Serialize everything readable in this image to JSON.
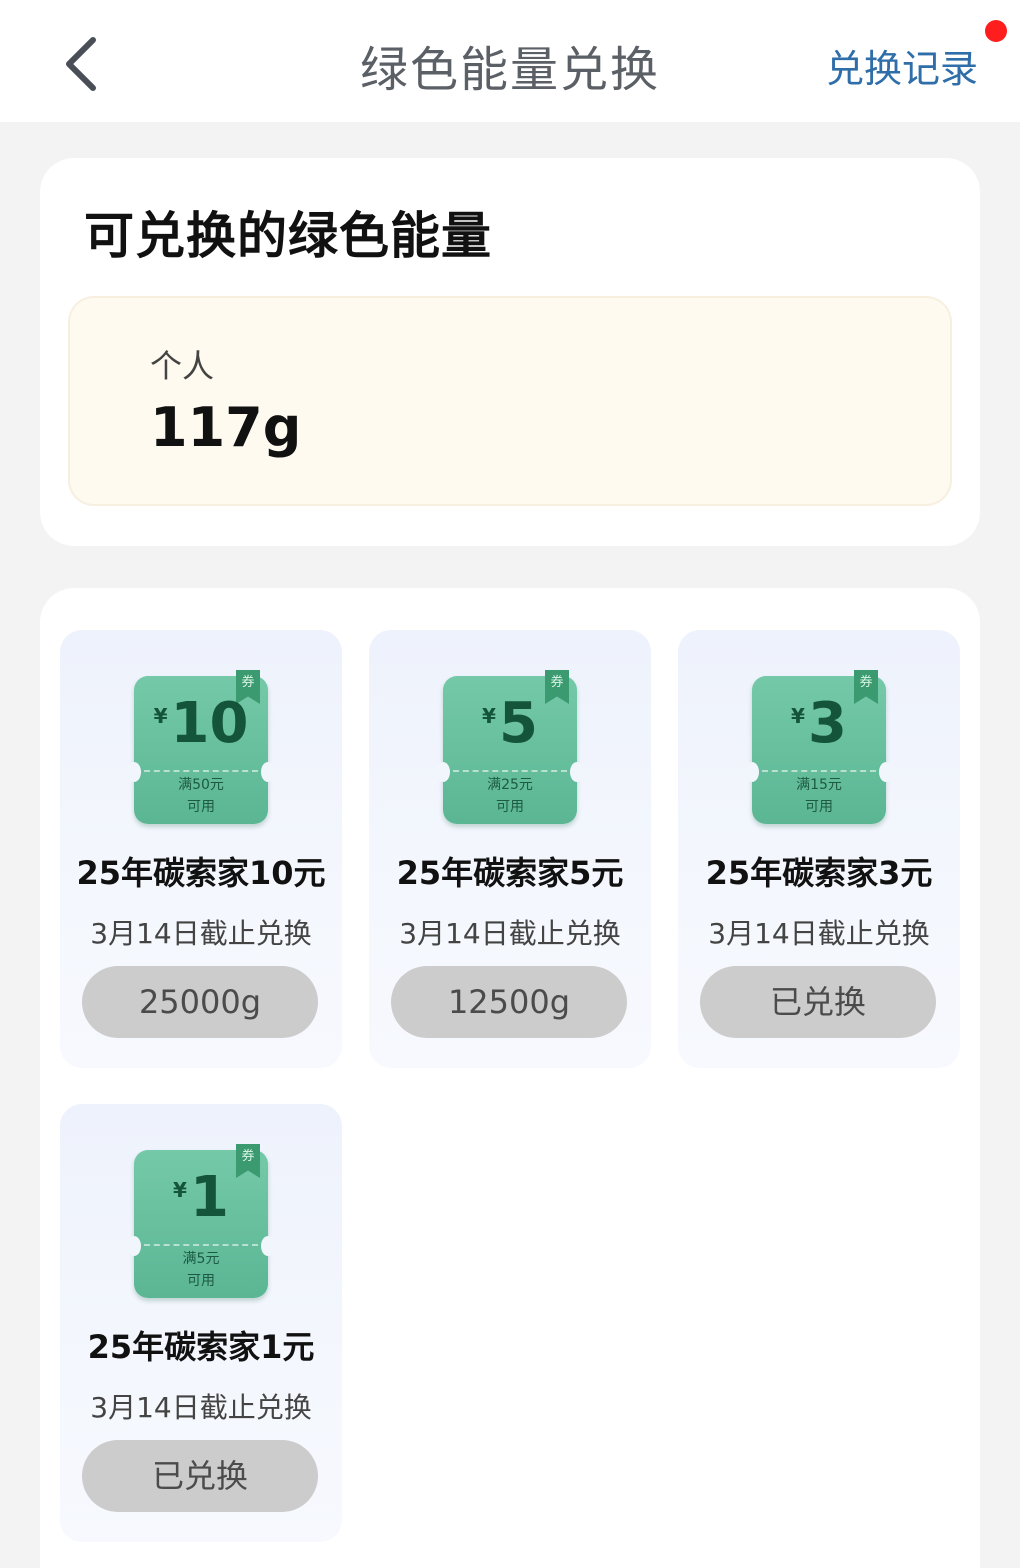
{
  "header": {
    "title": "绿色能量兑换",
    "records_label": "兑换记录",
    "back_icon": "chevron-left-icon"
  },
  "balance": {
    "title": "可兑换的绿色能量",
    "label": "个人",
    "value": "117g"
  },
  "coupons": [
    {
      "currency": "¥",
      "amount": "10",
      "cond_line1": "满50元",
      "cond_line2": "可用",
      "ribbon": "券",
      "name": "25年碳索家10元",
      "deadline": "3月14日截止兑换",
      "button": "25000g"
    },
    {
      "currency": "¥",
      "amount": "5",
      "cond_line1": "满25元",
      "cond_line2": "可用",
      "ribbon": "券",
      "name": "25年碳索家5元",
      "deadline": "3月14日截止兑换",
      "button": "12500g"
    },
    {
      "currency": "¥",
      "amount": "3",
      "cond_line1": "满15元",
      "cond_line2": "可用",
      "ribbon": "券",
      "name": "25年碳索家3元",
      "deadline": "3月14日截止兑换",
      "button": "已兑换"
    },
    {
      "currency": "¥",
      "amount": "1",
      "cond_line1": "满5元",
      "cond_line2": "可用",
      "ribbon": "券",
      "name": "25年碳索家1元",
      "deadline": "3月14日截止兑换",
      "button": "已兑换"
    }
  ],
  "colors": {
    "accent_link": "#2f6ea8",
    "notification_dot": "#ff1e1e",
    "coupon_green": "#5bb694",
    "button_gray": "#cccccc"
  }
}
